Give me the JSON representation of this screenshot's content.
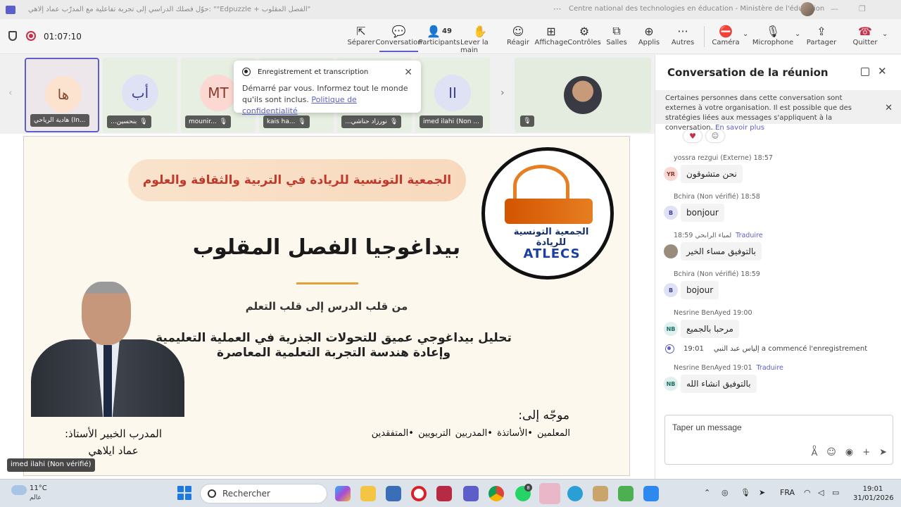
{
  "titlebar": {
    "title": "حوّل فصلك الدراسي إلى تجربة تفاعلية مع المدرّب عماد إلاهي: \"\"Edpuzzle + الفصل المقلوب\"",
    "more": "···",
    "org": "Centre national des technologies en éducation - Ministère de l'éducation",
    "minimize": "—",
    "restore": "❐"
  },
  "toolbar": {
    "timer": "01:07:10",
    "buttons": [
      {
        "label": "Séparer",
        "icon": "⇱"
      },
      {
        "label": "Conversation",
        "icon": "💬"
      },
      {
        "label": "Participants",
        "icon": "👤",
        "count": "49"
      },
      {
        "label": "Lever la main",
        "icon": "✋"
      },
      {
        "label": "Réagir",
        "icon": "☺"
      },
      {
        "label": "Affichage",
        "icon": "⊞"
      },
      {
        "label": "Contrôles",
        "icon": "⚙"
      },
      {
        "label": "Salles",
        "icon": "⧉"
      },
      {
        "label": "Applis",
        "icon": "⊕"
      },
      {
        "label": "Autres",
        "icon": "···"
      },
      {
        "label": "Caméra",
        "icon": "⛔"
      },
      {
        "label": "Microphone",
        "icon": "🎙"
      },
      {
        "label": "Partager",
        "icon": "⇪"
      },
      {
        "label": "Quitter",
        "icon": "☎"
      }
    ]
  },
  "participants": [
    {
      "initials": "ها",
      "name": "هادية الرياحي (In...",
      "color": "#fbe3cf",
      "selected": true
    },
    {
      "initials": "أب",
      "name": "...بنحسين",
      "color": "#dfe1f5"
    },
    {
      "initials": "MT",
      "name": "mounir...",
      "color": "#fbd9d2"
    },
    {
      "initials": "",
      "name": "kais ha...",
      "color": "#e6efe1"
    },
    {
      "initials": "",
      "name": "...نورزاد حناشي",
      "color": "#e6efe1"
    },
    {
      "initials": "II",
      "name": "imed ilahi (Non ...",
      "color": "#dfe1f5"
    }
  ],
  "notification": {
    "title": "Enregistrement et transcription",
    "body": "Démarré par vous. Informez tout le monde qu'ils sont inclus.",
    "link": "Politique de confidentialité"
  },
  "slide": {
    "banner": "الجمعية التونسية للريادة في التربية والثقافة والعلوم",
    "logo_arabic": "الجمعية التونسية للريادة",
    "logo_latin": "ATLECS",
    "title": "بيداغوجيا الفصل المقلوب",
    "subtitle": "من قلب الدرس إلى قلب التعلم",
    "desc_line1": "تحليل بيداغوجي عميق للتحولات الجذرية في العملية التعليمية",
    "desc_line2": "وإعادة هندسة التجربة التعلمية المعاصرة",
    "trainer_line1": "المدرب الخبير الأستاذ:",
    "trainer_line2": "عماد ايلاهي",
    "target_heading": "موجّه إلى:",
    "target_list": "المعلمين  •الأساتذة  •المدربين التربويين  •المتفقدين"
  },
  "speaker_tag": "imed ilahi (Non vérifié)",
  "chat": {
    "title": "Conversation de la réunion",
    "notice": "Certaines personnes dans cette conversation sont externes à votre organisation. Il est possible que des stratégies liées aux messages s'appliquent à la conversation.",
    "notice_link": "En savoir plus",
    "messages": [
      {
        "author": "yossra rezgui (Externe)",
        "time": "18:57",
        "initials": "YR",
        "avatar_color": "#fbd9d2",
        "text": "نحن متشوقون",
        "translate": ""
      },
      {
        "author": "Bchira (Non vérifié)",
        "time": "18:58",
        "initials": "B",
        "avatar_color": "#dfe1f5",
        "text": "bonjour",
        "translate": ""
      },
      {
        "author": "لمياء الرابحي",
        "time": "18:59",
        "initials": "",
        "avatar_color": "#9a8c7c",
        "text": "بالتوفيق مساء الخير",
        "translate": "Traduire"
      },
      {
        "author": "Bchira (Non vérifié)",
        "time": "18:59",
        "initials": "B",
        "avatar_color": "#dfe1f5",
        "text": "bojour",
        "translate": ""
      },
      {
        "author": "Nesrine BenAyed",
        "time": "19:00",
        "initials": "NB",
        "avatar_color": "#dff0ee",
        "text": "مرحبا بالجميع",
        "translate": ""
      },
      {
        "author": "Nesrine BenAyed",
        "time": "19:01",
        "initials": "NB",
        "avatar_color": "#dff0ee",
        "text": "بالتوفيق انشاء الله",
        "translate": "Traduire"
      }
    ],
    "system": {
      "time": "19:01",
      "text": "إلياس عبد النبي a commencé l'enregistrement"
    },
    "compose_placeholder": "Taper un message"
  },
  "taskbar": {
    "temp": "11°C",
    "weather": "عالم",
    "search": "Rechercher",
    "lang": "FRA",
    "time": "19:01",
    "date": "31/01/2026",
    "badge_teams": "8",
    "badge_whatsapp": "8"
  }
}
